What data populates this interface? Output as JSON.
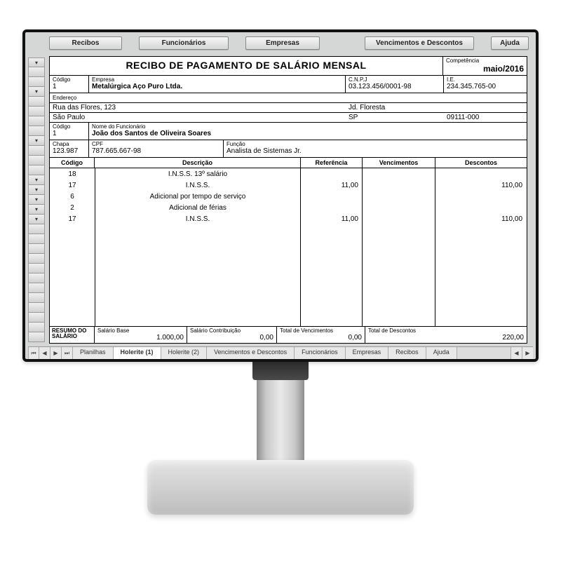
{
  "toolbar": {
    "recibos": "Recibos",
    "funcionarios": "Funcionários",
    "empresas": "Empresas",
    "venc_desc": "Vencimentos e Descontos",
    "ajuda": "Ajuda"
  },
  "doc": {
    "title": "RECIBO DE PAGAMENTO DE SALÁRIO MENSAL",
    "competencia_label": "Competência",
    "competencia": "maio/2016",
    "company": {
      "codigo_label": "Código",
      "codigo": "1",
      "empresa_label": "Empresa",
      "empresa": "Metalúrgica Aço Puro Ltda.",
      "cnpj_label": "C.N.P.J",
      "cnpj": "03.123.456/0001-98",
      "ie_label": "I.E.",
      "ie": "234.345.765-00",
      "endereco_label": "Endereço",
      "endereco": "Rua das Flores, 123",
      "bairro": "Jd. Floresta",
      "cidade": "São Paulo",
      "uf": "SP",
      "cep": "09111-000"
    },
    "employee": {
      "codigo_label": "Código",
      "codigo": "1",
      "nome_label": "Nome do Funcionário",
      "nome": "João dos Santos de Oliveira Soares",
      "chapa_label": "Chapa",
      "chapa": "123.987",
      "cpf_label": "CPF",
      "cpf": "787.665.667-98",
      "funcao_label": "Função",
      "funcao": "Analista de Sistemas Jr."
    },
    "items_header": {
      "codigo": "Código",
      "descricao": "Descrição",
      "referencia": "Referência",
      "vencimentos": "Vencimentos",
      "descontos": "Descontos"
    },
    "items": [
      {
        "codigo": "18",
        "descricao": "I.N.S.S. 13º salário",
        "referencia": "",
        "vencimentos": "",
        "descontos": ""
      },
      {
        "codigo": "17",
        "descricao": "I.N.S.S.",
        "referencia": "11,00",
        "vencimentos": "",
        "descontos": "110,00"
      },
      {
        "codigo": "6",
        "descricao": "Adicional por tempo de serviço",
        "referencia": "",
        "vencimentos": "",
        "descontos": ""
      },
      {
        "codigo": "2",
        "descricao": "Adicional de férias",
        "referencia": "",
        "vencimentos": "",
        "descontos": ""
      },
      {
        "codigo": "17",
        "descricao": "I.N.S.S.",
        "referencia": "11,00",
        "vencimentos": "",
        "descontos": "110,00"
      }
    ],
    "resumo": {
      "label": "RESUMO DO SALÁRIO",
      "salario_base_label": "Salário Base",
      "salario_base": "1.000,00",
      "salario_contrib_label": "Salário Contribuição",
      "salario_contrib": "0,00",
      "total_venc_label": "Total de Vencimentos",
      "total_venc": "0,00",
      "total_desc_label": "Total de Descontos",
      "total_desc": "220,00"
    }
  },
  "tabs": {
    "nav_first": "⏮",
    "nav_prev": "◀",
    "nav_next": "▶",
    "nav_last": "⏭",
    "items": [
      "Planilhas",
      "Holerite (1)",
      "Holerite (2)",
      "Vencimentos e Descontos",
      "Funcionários",
      "Empresas",
      "Recibos",
      "Ajuda"
    ],
    "active_index": 1,
    "scroll_left": "◀",
    "scroll_right": "▶"
  }
}
